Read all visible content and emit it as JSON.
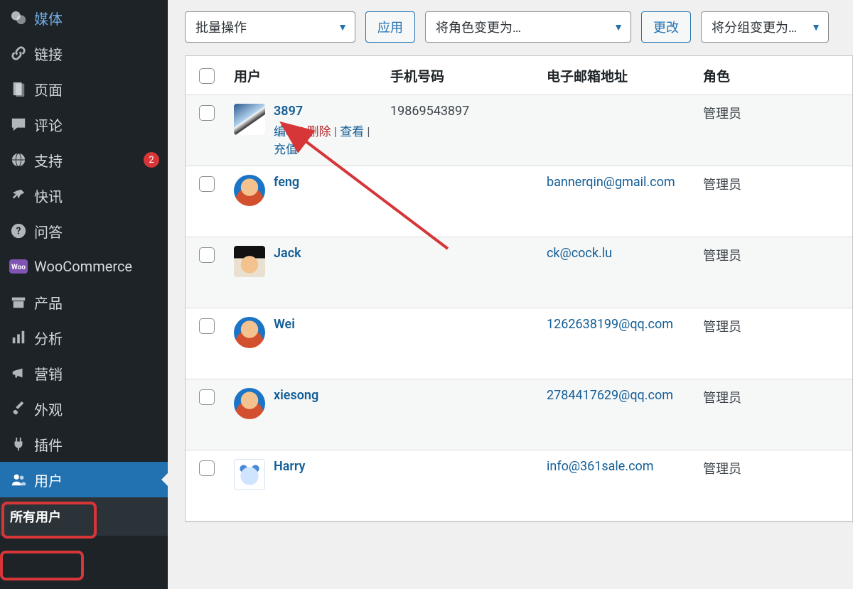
{
  "sidebar": {
    "items": [
      {
        "label": "媒体",
        "icon": "media"
      },
      {
        "label": "链接",
        "icon": "link"
      },
      {
        "label": "页面",
        "icon": "page"
      },
      {
        "label": "评论",
        "icon": "comment"
      },
      {
        "label": "支持",
        "icon": "globe",
        "badge": "2"
      },
      {
        "label": "快讯",
        "icon": "pin"
      },
      {
        "label": "问答",
        "icon": "help"
      },
      {
        "label": "WooCommerce",
        "icon": "woo"
      },
      {
        "label": "产品",
        "icon": "archive"
      },
      {
        "label": "分析",
        "icon": "stats"
      },
      {
        "label": "营销",
        "icon": "megaphone"
      },
      {
        "label": "外观",
        "icon": "brush"
      },
      {
        "label": "插件",
        "icon": "plugin"
      },
      {
        "label": "用户",
        "icon": "users"
      }
    ],
    "sub": "所有用户"
  },
  "toolbar": {
    "bulk_action": "批量操作",
    "apply": "应用",
    "change_role": "将角色变更为…",
    "change": "更改",
    "change_group": "将分组变更为…"
  },
  "table": {
    "headers": {
      "user": "用户",
      "phone": "手机号码",
      "email": "电子邮箱地址",
      "role": "角色"
    },
    "row_actions": {
      "edit": "编辑",
      "delete": "删除",
      "view": "查看",
      "recharge": "充值"
    },
    "rows": [
      {
        "username": "3897",
        "phone": "19869543897",
        "email": "",
        "role": "管理员",
        "avatar": "av-panda",
        "show_actions": true
      },
      {
        "username": "feng",
        "phone": "",
        "email": "bannerqin@gmail.com",
        "role": "管理员",
        "avatar": "av-person"
      },
      {
        "username": "Jack",
        "phone": "",
        "email": "ck@cock.lu",
        "role": "管理员",
        "avatar": "av-jack"
      },
      {
        "username": "Wei",
        "phone": "",
        "email": "1262638199@qq.com",
        "role": "管理员",
        "avatar": "av-person"
      },
      {
        "username": "xiesong",
        "phone": "",
        "email": "2784417629@qq.com",
        "role": "管理员",
        "avatar": "av-person"
      },
      {
        "username": "Harry",
        "phone": "",
        "email": "info@361sale.com",
        "role": "管理员",
        "avatar": "av-dragon"
      }
    ]
  }
}
